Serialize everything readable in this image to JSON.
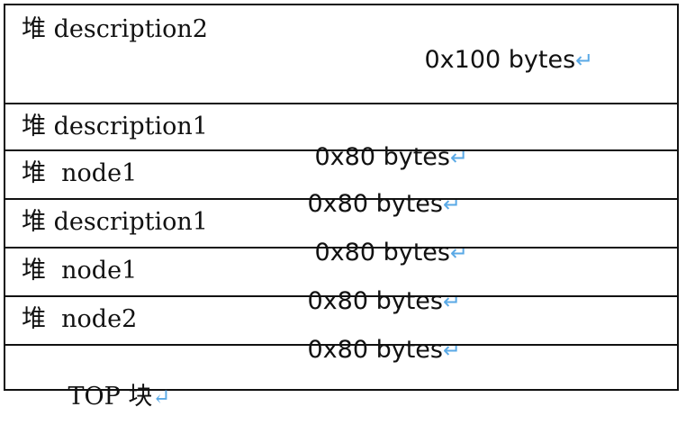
{
  "rows": [
    {
      "name": "堆 description2",
      "size": "0x100 bytes",
      "mark": "↵"
    },
    {
      "name": "堆 description1",
      "size": "0x80 bytes",
      "mark": "↵"
    },
    {
      "name": "堆  node1",
      "size": "0x80 bytes",
      "mark": "↵"
    },
    {
      "name": "堆 description1",
      "size": "0x80 bytes",
      "mark": "↵"
    },
    {
      "name": "堆  node1",
      "size": "0x80 bytes",
      "mark": "↵"
    },
    {
      "name": "堆  node2",
      "size": "0x80 bytes",
      "mark": "↵"
    }
  ],
  "footer": {
    "label": "TOP 块",
    "mark": "↵"
  }
}
